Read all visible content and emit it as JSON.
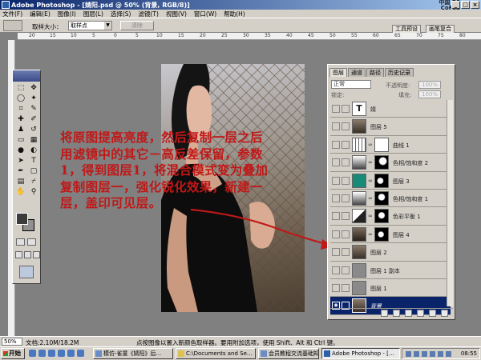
{
  "window": {
    "title": "Adobe Photoshop - [婧阳.psd @ 50% (背景, RGB/8)]",
    "watermark": "中国 PS\nCoFeb",
    "buttons": [
      "_",
      "□",
      "×"
    ]
  },
  "menu": [
    "文件(F)",
    "编辑(E)",
    "图像(I)",
    "图层(L)",
    "选择(S)",
    "滤镜(T)",
    "视图(V)",
    "窗口(W)",
    "帮助(H)"
  ],
  "options": {
    "sample_label": "取样大小：",
    "sample_value": "取样点",
    "clear_label": "清除",
    "tab_presets": "工具预设",
    "tab_brushes": "画笔复合"
  },
  "ruler_ticks": [
    "20",
    "15",
    "10",
    "5",
    "0",
    "5",
    "10",
    "15",
    "20",
    "25",
    "30",
    "35",
    "40",
    "45",
    "50",
    "55",
    "60",
    "65",
    "70",
    "75",
    "80"
  ],
  "annotation": {
    "lines": [
      "将原图提高亮度，然后复制一层之后",
      "用滤镜中的其它－高反差保留，参数",
      "1，得到图层1，将混合模式变为叠加",
      "复制图层一，强化锐化效果，新建一",
      "层，盖印可见层。"
    ]
  },
  "layers_panel": {
    "tabs": [
      "图层",
      "通道",
      "路径",
      "历史记录"
    ],
    "blend_mode": "正常",
    "opacity_label": "不透明度:",
    "opacity_value": "100%",
    "lock_label": "锁定:",
    "fill_label": "填充:",
    "fill_value": "100%",
    "layers": [
      {
        "name": "婧",
        "type": "text",
        "selected": false
      },
      {
        "name": "图层 5",
        "type": "photo",
        "selected": false
      },
      {
        "name": "曲线 1",
        "type": "adjust",
        "selected": false
      },
      {
        "name": "色相/饱和度 2",
        "type": "adjust-mask",
        "selected": false
      },
      {
        "name": "图层 3",
        "type": "teal",
        "selected": false
      },
      {
        "name": "色相/饱和度 1",
        "type": "adjust-mask",
        "selected": false
      },
      {
        "name": "色彩平衡 1",
        "type": "adjust-mask",
        "selected": false
      },
      {
        "name": "图层 4",
        "type": "photo-mask",
        "selected": false
      },
      {
        "name": "图层 2",
        "type": "photo",
        "selected": false
      },
      {
        "name": "图层 1 副本",
        "type": "gray",
        "selected": false
      },
      {
        "name": "图层 1",
        "type": "gray",
        "selected": false
      },
      {
        "name": "背景",
        "type": "photo",
        "selected": true
      }
    ]
  },
  "status": {
    "zoom": "50%",
    "doc": "文档:2.10M/18.2M",
    "hint": "点按图像以置入新颜色取样器。要用附加选项，使用 Shift、Alt 和 Ctrl 键。"
  },
  "taskbar": {
    "start": "开始",
    "tasks": [
      "模仿-雀童《婧阳》后...",
      "C:\\Documents and Se...",
      "会员教程交流基础知...",
      "Adobe Photoshop - [..."
    ],
    "clock": "08:55"
  },
  "colors": {
    "annotation": "#c01818",
    "selected_layer": "#0a246a",
    "chrome": "#d4d0c8",
    "workspace": "#808080"
  }
}
